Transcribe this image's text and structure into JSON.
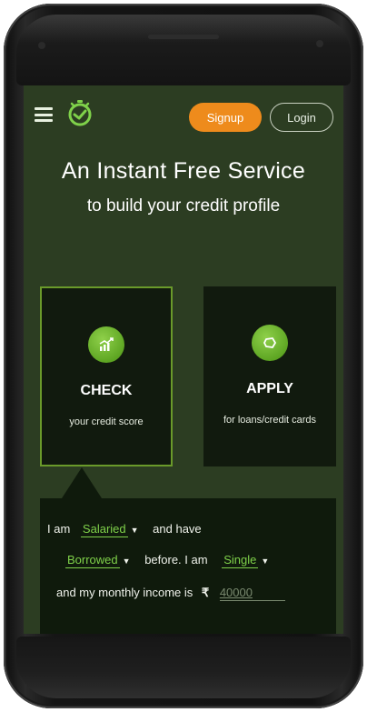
{
  "header": {
    "signup_label": "Signup",
    "login_label": "Login"
  },
  "hero": {
    "title": "An Instant Free Service",
    "subtitle": "to build your credit profile"
  },
  "cards": [
    {
      "title": "CHECK",
      "subtitle": "your credit score",
      "icon": "chart-icon"
    },
    {
      "title": "APPLY",
      "subtitle": "for loans/credit cards",
      "icon": "apply-icon"
    }
  ],
  "form": {
    "t1": "I am",
    "employment": "Salaried",
    "t2": "and have",
    "credit_history": "Borrowed",
    "t3": "before. I am",
    "marital": "Single",
    "t4": "and my monthly income is",
    "currency": "₹",
    "income_placeholder": "40000"
  },
  "colors": {
    "screen_bg": "#2c3d22",
    "card_bg": "#111a0e",
    "accent_orange": "#ee8b1c",
    "accent_green": "#7fd14a",
    "selected_border": "#6a9a2a"
  }
}
